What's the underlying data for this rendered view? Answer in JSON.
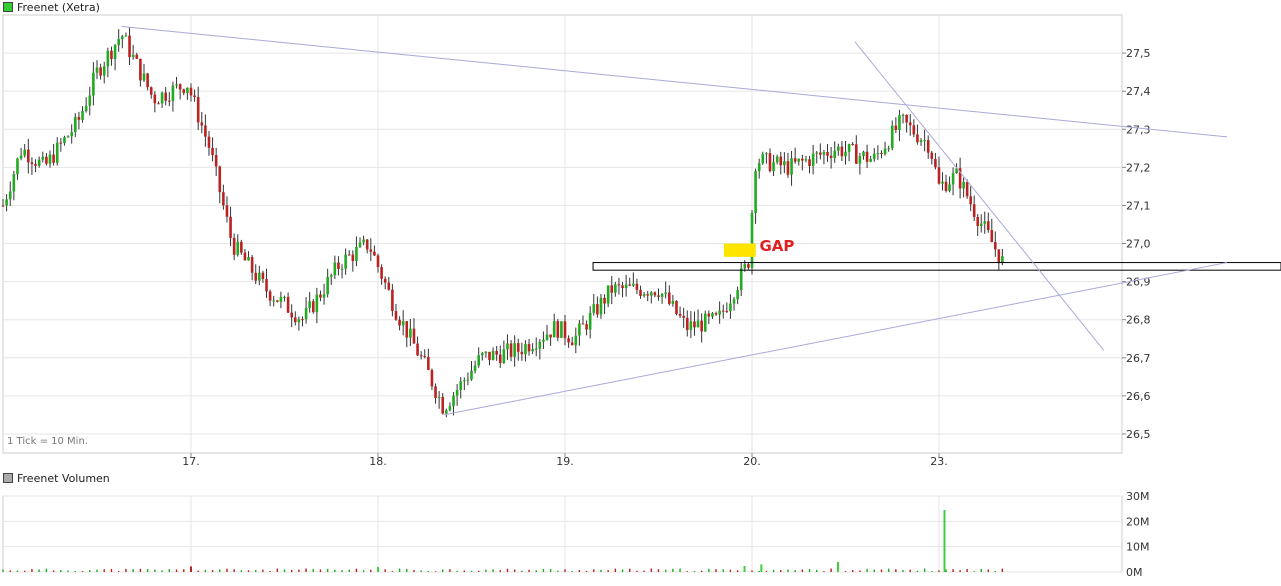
{
  "chart_data": [
    {
      "type": "candlestick",
      "title": "Freenet (Xetra)",
      "note": "1 Tick = 10 Min.",
      "x_ticks": [
        "17.",
        "18.",
        "19.",
        "20.",
        "23."
      ],
      "ylim": [
        26.45,
        27.6
      ],
      "y_ticks": [
        "27,5",
        "27,4",
        "27,3",
        "27,2",
        "27,1",
        "27,0",
        "26,9",
        "26,8",
        "26,7",
        "26,6",
        "26,5"
      ],
      "y_tick_values": [
        27.5,
        27.4,
        27.3,
        27.2,
        27.1,
        27.0,
        26.9,
        26.8,
        26.7,
        26.6,
        26.5
      ],
      "grid": true,
      "colors": {
        "up": "#22aa22",
        "down": "#bb2222",
        "trendline": "#a9a9d9",
        "gap": "#ffe400",
        "gap_text": "#e02020",
        "legend_swatch": "#33cc33"
      },
      "annotations": [
        {
          "text": "GAP",
          "color": "#e02020",
          "box_color": "#ffe400"
        }
      ],
      "anchor_closes": [
        [
          0.0,
          27.1
        ],
        [
          0.1,
          27.25
        ],
        [
          0.22,
          27.2
        ],
        [
          0.4,
          27.32
        ],
        [
          0.5,
          27.45
        ],
        [
          0.63,
          27.55
        ],
        [
          0.8,
          27.38
        ],
        [
          0.98,
          27.42
        ],
        [
          1.1,
          27.25
        ],
        [
          1.22,
          27.0
        ],
        [
          1.4,
          26.88
        ],
        [
          1.6,
          26.8
        ],
        [
          1.8,
          26.95
        ],
        [
          1.95,
          27.0
        ],
        [
          2.1,
          26.82
        ],
        [
          2.25,
          26.68
        ],
        [
          2.35,
          26.57
        ],
        [
          2.55,
          26.7
        ],
        [
          2.75,
          26.72
        ],
        [
          2.95,
          26.78
        ],
        [
          3.05,
          26.75
        ],
        [
          3.25,
          26.88
        ],
        [
          3.5,
          26.88
        ],
        [
          3.65,
          26.78
        ],
        [
          3.82,
          26.8
        ],
        [
          3.98,
          26.95
        ],
        [
          4.02,
          27.22
        ],
        [
          4.2,
          27.2
        ],
        [
          4.45,
          27.25
        ],
        [
          4.65,
          27.22
        ],
        [
          4.8,
          27.32
        ],
        [
          4.95,
          27.26
        ],
        [
          5.0,
          27.15
        ],
        [
          5.1,
          27.18
        ],
        [
          5.2,
          27.08
        ],
        [
          5.35,
          26.95
        ]
      ],
      "trendlines": [
        {
          "from": [
            0.63,
            27.57
          ],
          "to": [
            6.6,
            27.28
          ]
        },
        {
          "from": [
            2.35,
            26.55
          ],
          "to": [
            6.6,
            26.95
          ]
        },
        {
          "from": [
            4.55,
            27.53
          ],
          "to": [
            5.9,
            26.72
          ]
        }
      ],
      "support_band": [
        26.93,
        26.95
      ]
    },
    {
      "type": "bar",
      "title": "Freenet Volumen",
      "y_ticks": [
        "30M",
        "20M",
        "10M",
        "0M"
      ],
      "y_tick_values": [
        30,
        20,
        10,
        0
      ],
      "ylim": [
        0,
        30
      ],
      "unit": "M",
      "spikes": [
        {
          "x": 1.0,
          "value": 2.2,
          "up": false
        },
        {
          "x": 2.0,
          "value": 2.0,
          "up": true
        },
        {
          "x": 3.96,
          "value": 2.4,
          "up": true
        },
        {
          "x": 4.05,
          "value": 3.0,
          "up": true
        },
        {
          "x": 4.46,
          "value": 4.0,
          "up": true
        },
        {
          "x": 5.03,
          "value": 24.5,
          "up": true
        }
      ]
    }
  ]
}
